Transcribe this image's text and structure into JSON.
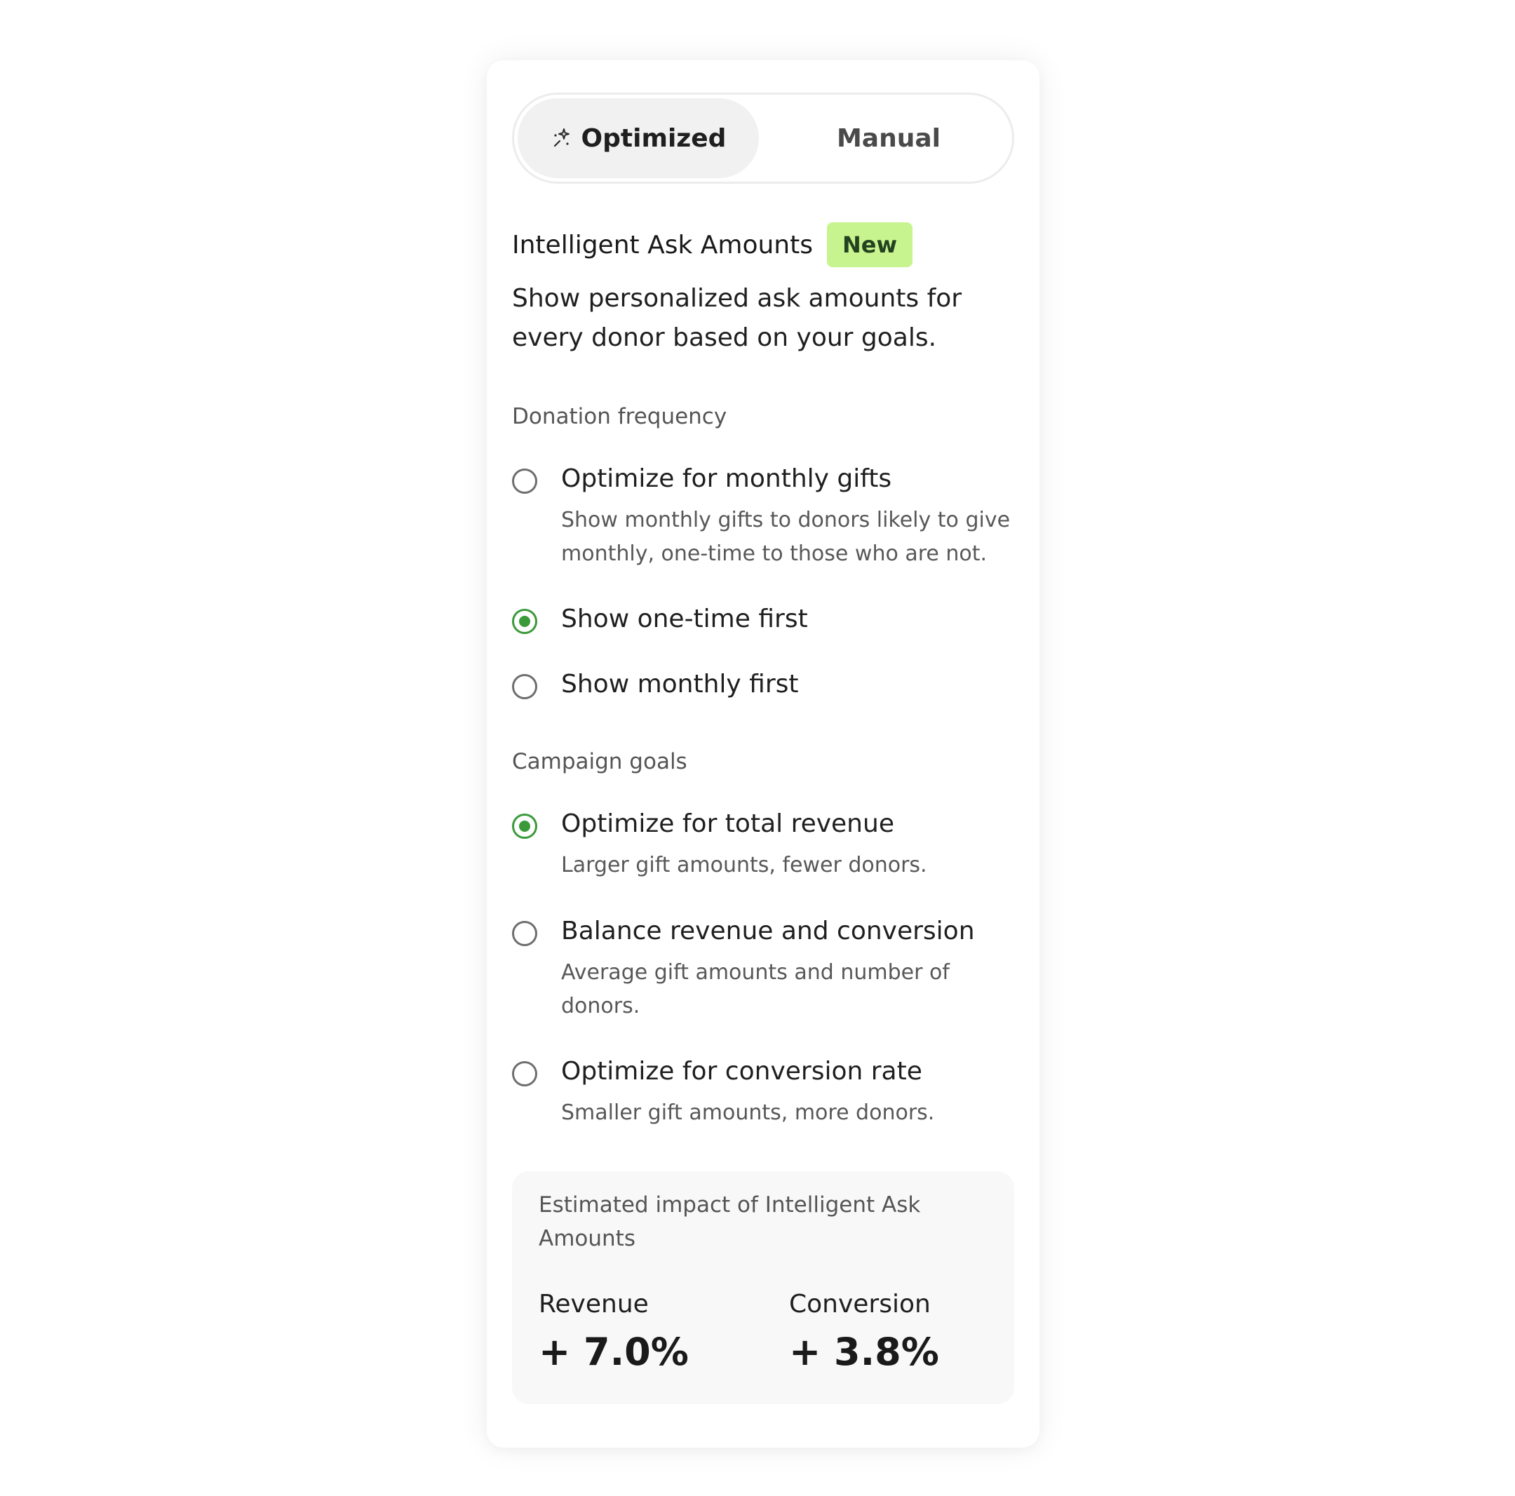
{
  "toggle": {
    "optimized_label": "Optimized",
    "manual_label": "Manual",
    "selected": "Optimized"
  },
  "feature": {
    "title": "Intelligent Ask Amounts",
    "badge": "New",
    "description": "Show personalized ask amounts for every donor based on your goals."
  },
  "donation_frequency": {
    "title": "Donation frequency",
    "options": [
      {
        "label": "Optimize for monthly gifts",
        "description": "Show monthly gifts to donors likely to give monthly, one-time to those who are not.",
        "checked": false
      },
      {
        "label": "Show one-time first",
        "checked": true
      },
      {
        "label": "Show monthly first",
        "checked": false
      }
    ]
  },
  "campaign_goals": {
    "title": "Campaign goals",
    "options": [
      {
        "label": "Optimize for total revenue",
        "description": "Larger gift amounts, fewer donors.",
        "checked": true
      },
      {
        "label": "Balance revenue and conversion",
        "description": "Average gift amounts and number of donors.",
        "checked": false
      },
      {
        "label": "Optimize for conversion rate",
        "description": "Smaller gift amounts, more donors.",
        "checked": false
      }
    ]
  },
  "impact": {
    "title": "Estimated impact of Intelligent Ask Amounts",
    "revenue_label": "Revenue",
    "revenue_value": "+ 7.0%",
    "conversion_label": "Conversion",
    "conversion_value": "+ 3.8%"
  },
  "colors": {
    "accent_green": "#3a9a3a",
    "badge_bg": "#c7f48e",
    "badge_text": "#234320"
  },
  "icons": {
    "optimized": "sparkle-icon"
  }
}
